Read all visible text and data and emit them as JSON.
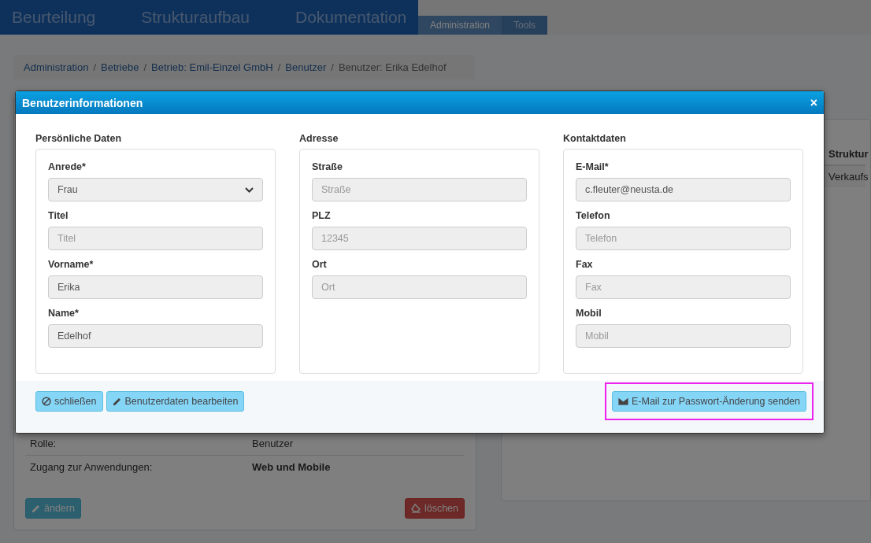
{
  "header": {
    "nav": [
      {
        "label": "Beurteilung"
      },
      {
        "label": "Strukturaufbau"
      },
      {
        "label": "Dokumentation"
      }
    ],
    "tabs": [
      {
        "label": "Administration",
        "selected": true
      },
      {
        "label": "Tools",
        "selected": false
      }
    ]
  },
  "breadcrumb": [
    {
      "label": "Administration",
      "current": false
    },
    {
      "separator": "/",
      "label": "Betriebe",
      "current": false
    },
    {
      "separator": "/",
      "label": "Betrieb: Emil-Einzel GmbH",
      "current": false
    },
    {
      "separator": "/",
      "label": "Benutzer",
      "current": false
    },
    {
      "separator": "/",
      "label": "Benutzer: Erika Edelhof",
      "current": true
    }
  ],
  "user_panel": {
    "rows": [
      {
        "label": "Rolle:",
        "value": "Benutzer",
        "bold": false
      },
      {
        "label": "Zugang zur Anwendungen:",
        "value": "Web und Mobile",
        "bold": true
      }
    ],
    "buttons": [
      {
        "label": "ändern",
        "kind": "edit"
      },
      {
        "label": "löschen",
        "kind": "delete"
      }
    ]
  },
  "structure_panel": {
    "column": "Struktur",
    "row": "Verkaufs"
  },
  "modal": {
    "title": "Benutzerinformationen",
    "close": "×",
    "sections": [
      {
        "title": "Persönliche Daten",
        "fields": [
          {
            "label": "Anrede*",
            "kind": "select",
            "value": "Frau"
          },
          {
            "label": "Titel",
            "kind": "input",
            "placeholder": "Titel"
          },
          {
            "label": "Vorname*",
            "kind": "input",
            "value": "Erika"
          },
          {
            "label": "Name*",
            "kind": "input",
            "value": "Edelhof"
          }
        ]
      },
      {
        "title": "Adresse",
        "fields": [
          {
            "label": "Straße",
            "kind": "input",
            "placeholder": "Straße"
          },
          {
            "label": "PLZ",
            "kind": "input",
            "placeholder": "12345"
          },
          {
            "label": "Ort",
            "kind": "input",
            "placeholder": "Ort"
          }
        ]
      },
      {
        "title": "Kontaktdaten",
        "fields": [
          {
            "label": "E-Mail*",
            "kind": "input",
            "value": "c.fleuter@neusta.de"
          },
          {
            "label": "Telefon",
            "kind": "input",
            "placeholder": "Telefon"
          },
          {
            "label": "Fax",
            "kind": "input",
            "placeholder": "Fax"
          },
          {
            "label": "Mobil",
            "kind": "input",
            "placeholder": "Mobil"
          }
        ]
      }
    ],
    "footer_buttons": [
      {
        "label": "schließen",
        "kind": "close",
        "highlighted": false
      },
      {
        "label": "Benutzerdaten bearbeiten",
        "kind": "edit",
        "highlighted": false
      },
      {
        "label": "E-Mail zur Passwort-Änderung senden",
        "kind": "mail",
        "highlighted": true
      }
    ]
  }
}
